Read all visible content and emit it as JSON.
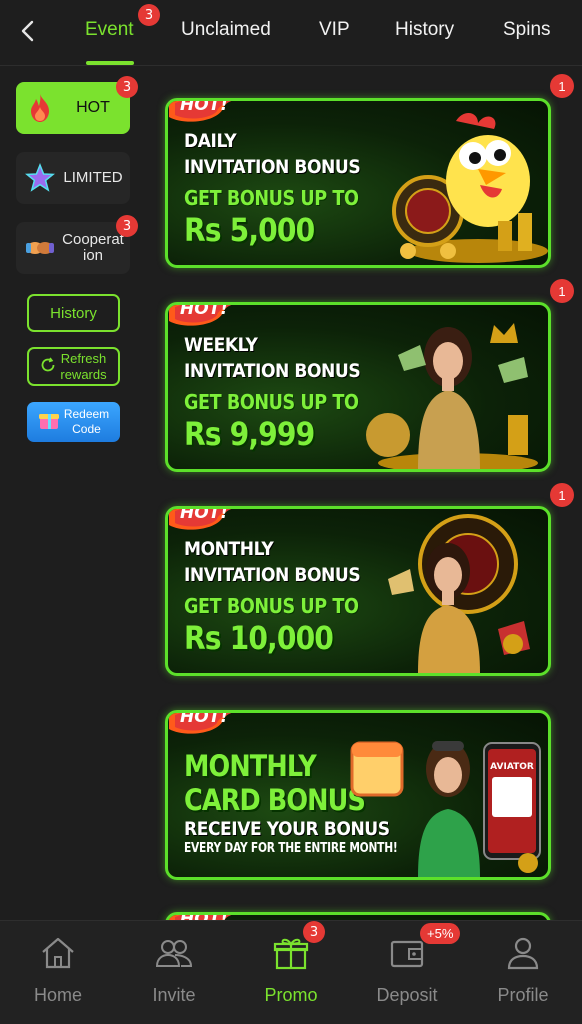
{
  "tabs": [
    {
      "label": "Event",
      "badge": "3",
      "active": true
    },
    {
      "label": "Unclaimed"
    },
    {
      "label": "VIP"
    },
    {
      "label": "History"
    },
    {
      "label": "Spins"
    }
  ],
  "sidebar": {
    "items": [
      {
        "label": "HOT",
        "badge": "3",
        "icon": "flame-icon",
        "active": true
      },
      {
        "label": "LIMITED",
        "icon": "star-icon"
      },
      {
        "label": "Cooperat ion",
        "badge": "3",
        "icon": "handshake-icon"
      }
    ],
    "history_label": "History",
    "refresh_label_1": "Refresh",
    "refresh_label_2": "rewards",
    "redeem_label_1": "Redeem",
    "redeem_label_2": "Code"
  },
  "banners": [
    {
      "tag": "HOT!",
      "line1": "DAILY",
      "line2": "INVITATION BONUS",
      "sub": "GET BONUS UP TO",
      "amount": "Rs 5,000",
      "notification": "1"
    },
    {
      "tag": "HOT!",
      "line1": "WEEKLY",
      "line2": "INVITATION BONUS",
      "sub": "GET BONUS UP TO",
      "amount": "Rs 9,999",
      "notification": "1"
    },
    {
      "tag": "HOT!",
      "line1": "MONTHLY",
      "line2": "INVITATION BONUS",
      "sub": "GET BONUS UP TO",
      "amount": "Rs 10,000",
      "notification": "1"
    },
    {
      "tag": "HOT!",
      "big1": "MONTHLY",
      "big2": "CARD BONUS",
      "line1": "RECEIVE YOUR BONUS",
      "small": "EVERY DAY FOR THE ENTIRE MONTH!",
      "art_label": "AVIATOR"
    },
    {
      "tag": "HOT!"
    }
  ],
  "bottom_nav": [
    {
      "label": "Home",
      "icon": "home-icon"
    },
    {
      "label": "Invite",
      "icon": "users-icon"
    },
    {
      "label": "Promo",
      "icon": "gift-icon",
      "badge": "3",
      "active": true
    },
    {
      "label": "Deposit",
      "icon": "wallet-icon",
      "badge": "+5%"
    },
    {
      "label": "Profile",
      "icon": "profile-icon"
    }
  ],
  "colors": {
    "accent": "#7be22e",
    "background": "#1e1e1e",
    "badge": "#e53935",
    "banner_border": "#5ce02a"
  }
}
